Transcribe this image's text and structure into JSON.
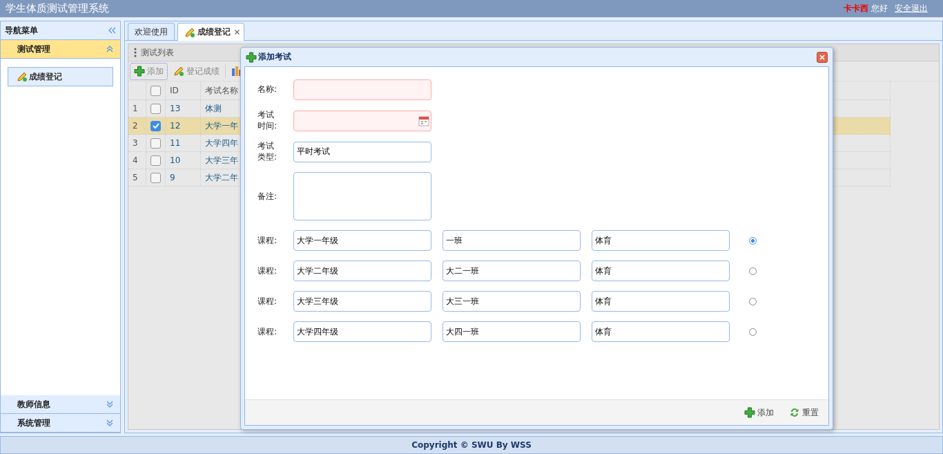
{
  "header": {
    "title": "学生体质测试管理系统",
    "user_name": "卡卡西",
    "greeting": "您好",
    "logout": "安全退出"
  },
  "sidebar": {
    "title": "导航菜单",
    "groups": [
      {
        "label": "测试管理",
        "expanded": true,
        "items": [
          {
            "label": "成绩登记",
            "selected": true
          }
        ]
      },
      {
        "label": "教师信息",
        "expanded": false
      },
      {
        "label": "系统管理",
        "expanded": false
      }
    ]
  },
  "tabs": [
    {
      "label": "欢迎使用",
      "selected": false,
      "closable": false
    },
    {
      "label": "成绩登记",
      "selected": true,
      "closable": true
    }
  ],
  "panel": {
    "title": "测试列表",
    "toolbar": [
      {
        "kind": "add",
        "label": "添加"
      },
      {
        "kind": "edit",
        "label": "登记成绩"
      },
      {
        "kind": "chart"
      }
    ]
  },
  "grid": {
    "columns": [
      "ID",
      "考试名称"
    ],
    "all_checked": false,
    "rows": [
      {
        "num": "1",
        "checked": false,
        "selected": false,
        "id": "13",
        "name": "体测"
      },
      {
        "num": "2",
        "checked": true,
        "selected": true,
        "id": "12",
        "name": "大学一年"
      },
      {
        "num": "3",
        "checked": false,
        "selected": false,
        "id": "11",
        "name": "大学四年"
      },
      {
        "num": "4",
        "checked": false,
        "selected": false,
        "id": "10",
        "name": "大学三年"
      },
      {
        "num": "5",
        "checked": false,
        "selected": false,
        "id": "9",
        "name": "大学二年"
      }
    ]
  },
  "dialog": {
    "title": "添加考试",
    "fields": [
      {
        "kind": "text",
        "label": "名称:",
        "invalid": true
      },
      {
        "kind": "date",
        "label": "考试时间:",
        "invalid": true
      },
      {
        "kind": "text",
        "label": "考试类型:",
        "value": "平时考试",
        "invalid": false
      },
      {
        "kind": "textarea",
        "label": "备注:",
        "invalid": false
      }
    ],
    "courses": [
      {
        "label": "课程:",
        "grade": "大学一年级",
        "class": "一班",
        "subject": "体育",
        "selected": true
      },
      {
        "label": "课程:",
        "grade": "大学二年级",
        "class": "大二一班",
        "subject": "体育",
        "selected": false
      },
      {
        "label": "课程:",
        "grade": "大学三年级",
        "class": "大三一班",
        "subject": "体育",
        "selected": false
      },
      {
        "label": "课程:",
        "grade": "大学四年级",
        "class": "大四一班",
        "subject": "体育",
        "selected": false
      }
    ],
    "buttons": [
      {
        "kind": "add",
        "label": "添加"
      },
      {
        "kind": "reset",
        "label": "重置"
      }
    ]
  },
  "footer": {
    "copyright": "Copyright © SWU By WSS"
  }
}
